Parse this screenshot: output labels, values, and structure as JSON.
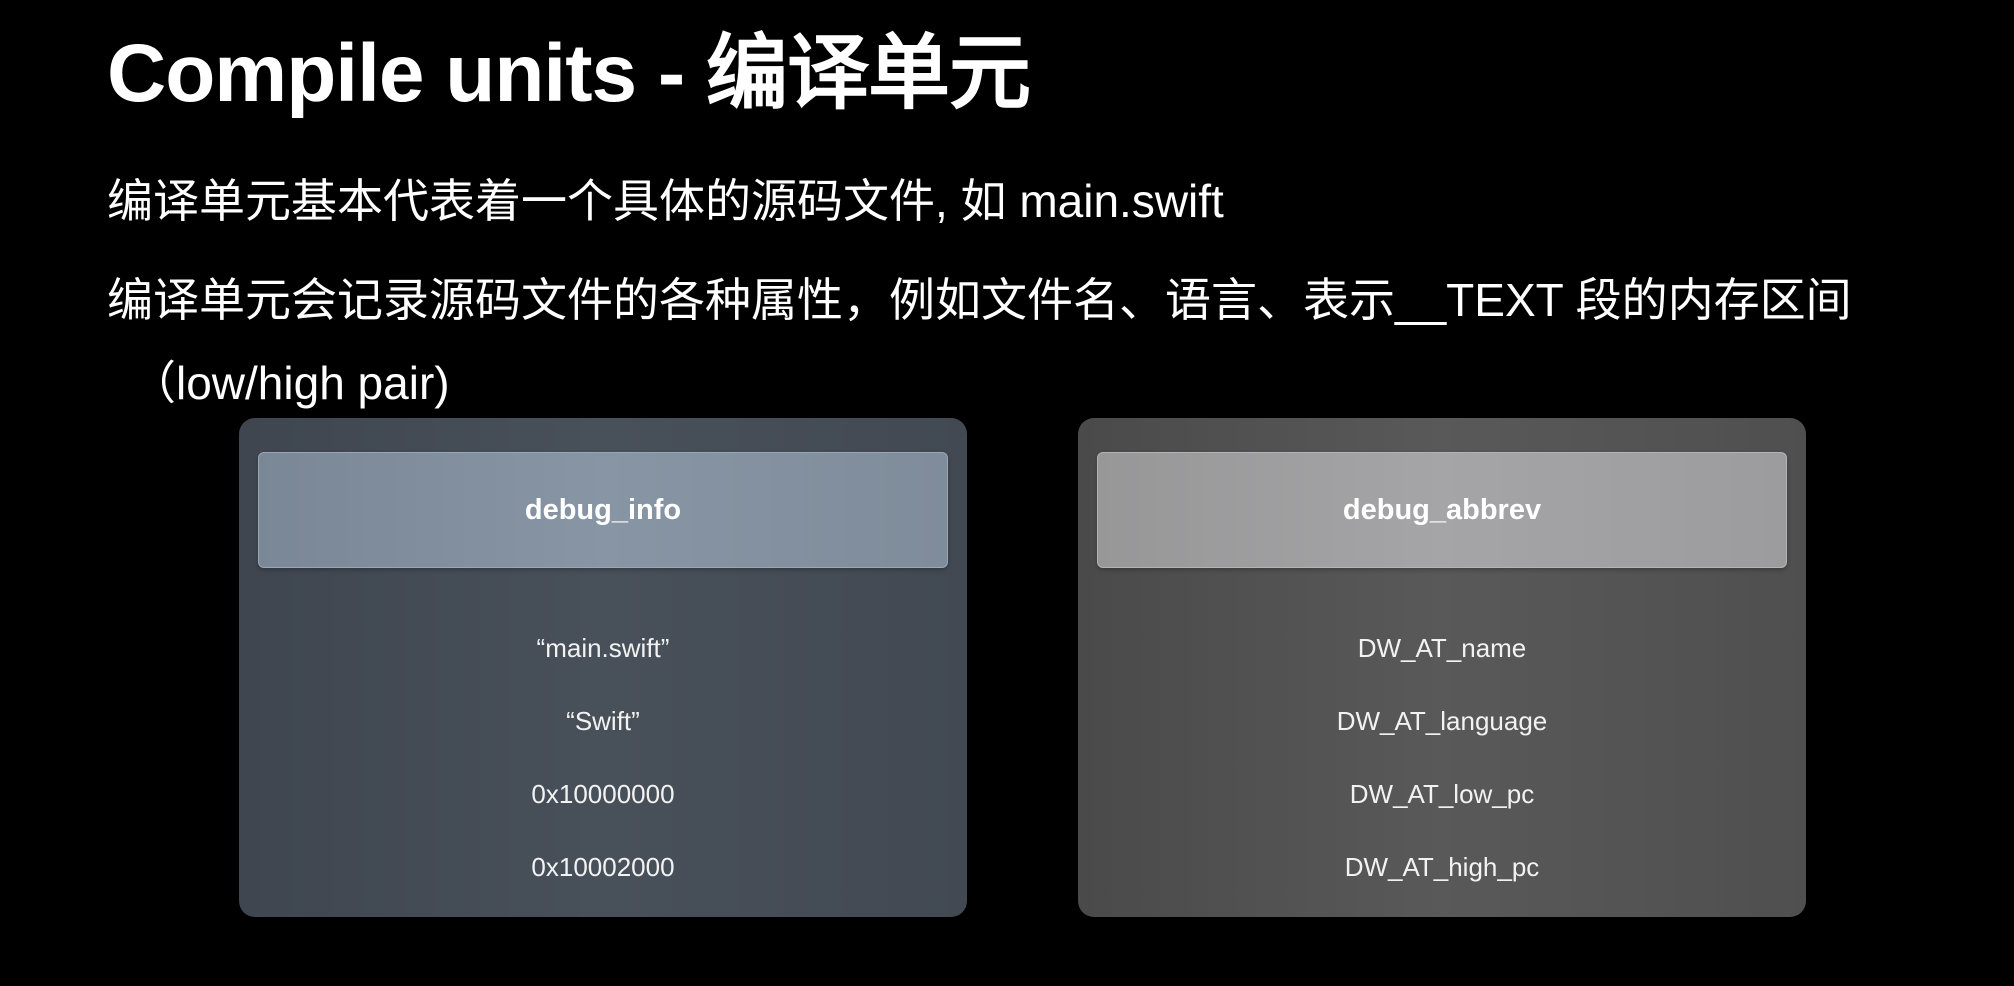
{
  "slide": {
    "title": "Compile units - 编译单元",
    "line_1": "编译单元基本代表着一个具体的源码文件, 如 main.swift",
    "line_2": "编译单元会记录源码文件的各种属性，例如文件名、语言、表示__TEXT 段的内存区间",
    "line_3": "（low/high pair)"
  },
  "debug_info": {
    "header": "debug_info",
    "rows": [
      "“main.swift”",
      "“Swift”",
      "0x10000000",
      "0x10002000"
    ]
  },
  "debug_abbrev": {
    "header": "debug_abbrev",
    "rows": [
      "DW_AT_name",
      "DW_AT_language",
      "DW_AT_low_pc",
      "DW_AT_high_pc"
    ]
  }
}
